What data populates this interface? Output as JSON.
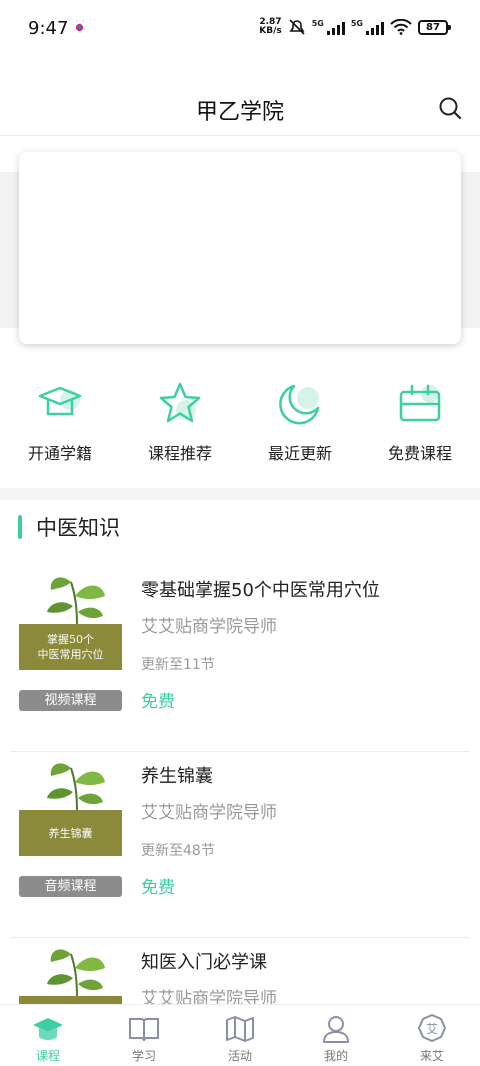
{
  "status_bar": {
    "time": "9:47",
    "net_speed_value": "2.87",
    "net_speed_unit": "KB/s",
    "sig1": "5G",
    "sig2": "5G",
    "battery": "87"
  },
  "header": {
    "title": "甲乙学院"
  },
  "quick_links": [
    {
      "label": "开通学籍",
      "icon": "graduation-cap-icon"
    },
    {
      "label": "课程推荐",
      "icon": "star-icon"
    },
    {
      "label": "最近更新",
      "icon": "moon-icon"
    },
    {
      "label": "免费课程",
      "icon": "ticket-icon"
    }
  ],
  "section": {
    "title": "中医知识"
  },
  "courses": [
    {
      "thumb_text": "掌握50个\n中医常用穴位",
      "tag": "视频课程",
      "name": "零基础掌握50个中医常用穴位",
      "teacher": "艾艾贴商学院导师",
      "update": "更新至11节",
      "price": "免费"
    },
    {
      "thumb_text": "养生锦囊",
      "tag": "音频课程",
      "name": "养生锦囊",
      "teacher": "艾艾贴商学院导师",
      "update": "更新至48节",
      "price": "免费"
    },
    {
      "thumb_text": "",
      "tag": "",
      "name": "知医入门必学课",
      "teacher": "艾艾贴商学院导师",
      "update": "",
      "price": ""
    }
  ],
  "tabbar": {
    "items": [
      {
        "label": "课程",
        "icon": "course-icon",
        "active": true
      },
      {
        "label": "学习",
        "icon": "book-icon",
        "active": false
      },
      {
        "label": "活动",
        "icon": "map-icon",
        "active": false
      },
      {
        "label": "我的",
        "icon": "user-icon",
        "active": false
      },
      {
        "label": "来艾",
        "icon": "ai-badge-icon",
        "active": false
      }
    ],
    "badge_char": "艾"
  },
  "colors": {
    "accent": "#3ccfa4",
    "thumb_green": "#8a8a3a"
  }
}
